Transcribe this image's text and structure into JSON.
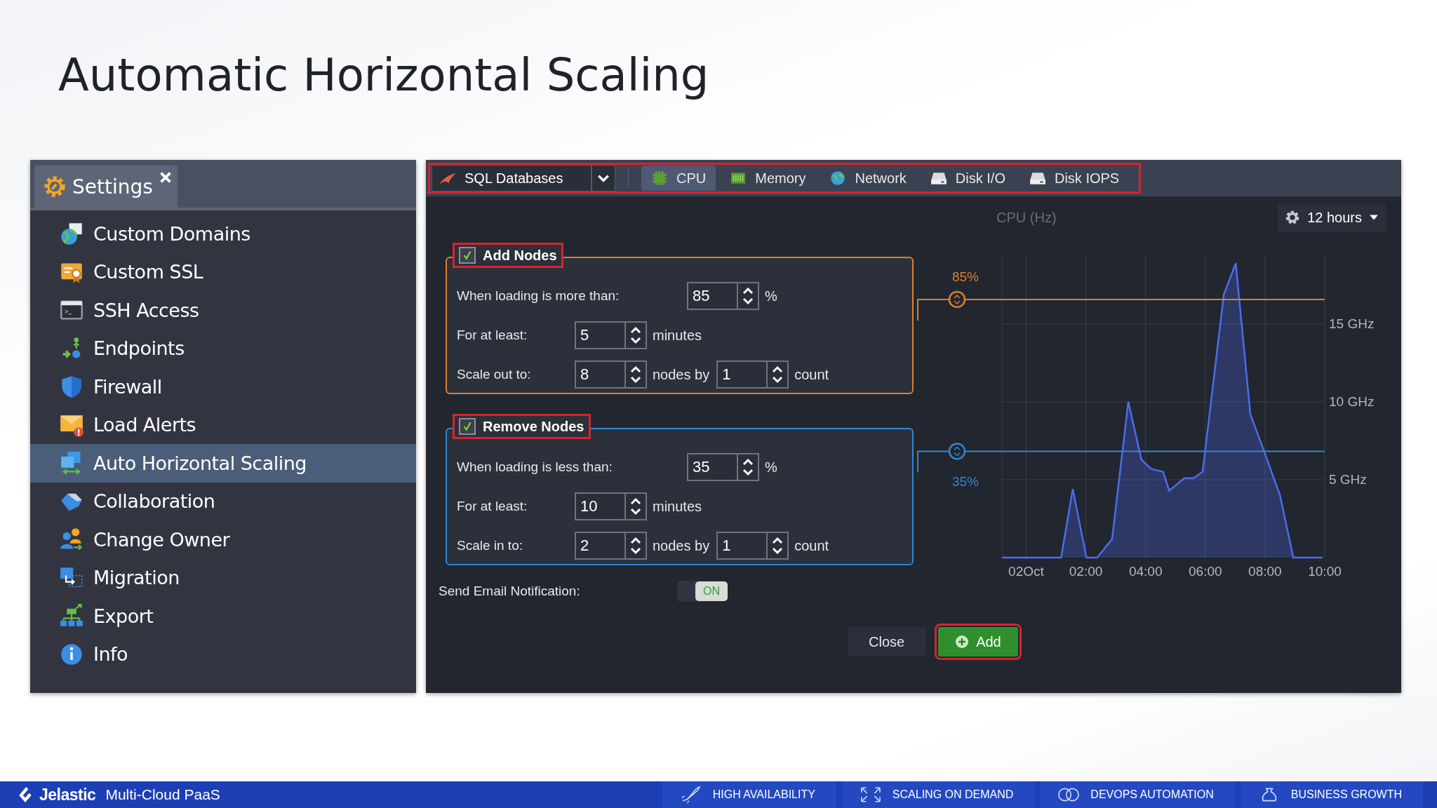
{
  "slide": {
    "title": "Automatic Horizontal Scaling"
  },
  "settings_panel": {
    "tab": "Settings",
    "items": [
      {
        "label": "Custom Domains",
        "selected": false
      },
      {
        "label": "Custom SSL",
        "selected": false
      },
      {
        "label": "SSH Access",
        "selected": false
      },
      {
        "label": "Endpoints",
        "selected": false
      },
      {
        "label": "Firewall",
        "selected": false
      },
      {
        "label": "Load Alerts",
        "selected": false
      },
      {
        "label": "Auto Horizontal Scaling",
        "selected": true
      },
      {
        "label": "Collaboration",
        "selected": false
      },
      {
        "label": "Change Owner",
        "selected": false
      },
      {
        "label": "Migration",
        "selected": false
      },
      {
        "label": "Export",
        "selected": false
      },
      {
        "label": "Info",
        "selected": false
      }
    ]
  },
  "scaling_panel": {
    "node_group": "SQL Databases",
    "tabs": [
      {
        "label": "CPU",
        "selected": true
      },
      {
        "label": "Memory",
        "selected": false
      },
      {
        "label": "Network",
        "selected": false
      },
      {
        "label": "Disk I/O",
        "selected": false
      },
      {
        "label": "Disk IOPS",
        "selected": false
      }
    ],
    "rules": [
      {
        "kind": "add",
        "label": "Add Nodes",
        "checked": true,
        "rows": [
          {
            "kind": "threshold",
            "label": "When loading is more than:",
            "value": "85",
            "unit": "%"
          },
          {
            "kind": "plain",
            "label": "For at least:",
            "value": "5",
            "unit": "minutes"
          },
          {
            "kind": "scale",
            "label": "Scale out to:",
            "value": "8",
            "unit": "nodes by",
            "value2": "1",
            "unit2": "count"
          }
        ]
      },
      {
        "kind": "remove",
        "label": "Remove Nodes",
        "checked": true,
        "rows": [
          {
            "kind": "threshold",
            "label": "When loading is less than:",
            "value": "35",
            "unit": "%"
          },
          {
            "kind": "plain",
            "label": "For at least:",
            "value": "10",
            "unit": "minutes"
          },
          {
            "kind": "scale",
            "label": "Scale in to:",
            "value": "2",
            "unit": "nodes by",
            "value2": "1",
            "unit2": "count"
          }
        ]
      }
    ],
    "email": {
      "label": "Send Email Notification:",
      "on": true,
      "toggle_text": "ON"
    },
    "buttons": [
      {
        "kind": "secondary",
        "label": "Close"
      },
      {
        "kind": "primary",
        "label": "Add"
      }
    ],
    "time_range": "12 hours",
    "chart_data": {
      "type": "area",
      "title": "CPU (Hz)",
      "x": [
        -0.81,
        1.17,
        1.56,
        2.02,
        2.38,
        2.88,
        3.42,
        3.86,
        4.18,
        4.59,
        4.79,
        5.3,
        5.6,
        5.91,
        6.62,
        7.02,
        7.51,
        7.94,
        8.5,
        8.95,
        9.93
      ],
      "grid": true,
      "series": [
        {
          "color": "#4a6cf0",
          "values": [
            0,
            0,
            4.4,
            0,
            0,
            1.2,
            10,
            6.3,
            5.7,
            5.5,
            4.3,
            5.1,
            5.1,
            5.5,
            16.9,
            18.9,
            9.2,
            7,
            4,
            0,
            0
          ]
        }
      ],
      "xlim": [
        -0.81,
        10
      ],
      "ylim": [
        0,
        19.5
      ],
      "xticks": [
        {
          "value": 0,
          "label": "02Oct"
        },
        {
          "value": 2,
          "label": "02:00"
        },
        {
          "value": 4,
          "label": "04:00"
        },
        {
          "value": 6,
          "label": "06:00"
        },
        {
          "value": 8,
          "label": "08:00"
        },
        {
          "value": 10,
          "label": "10:00"
        }
      ],
      "yticks": [
        {
          "value": 5,
          "label": "5 GHz"
        },
        {
          "value": 10,
          "label": "10 GHz"
        },
        {
          "value": 15,
          "label": "15 GHz"
        }
      ]
    },
    "thresholds": [
      {
        "label": "85%",
        "color": "#d9802f"
      },
      {
        "label": "35%",
        "color": "#2f86d4"
      }
    ]
  },
  "footer": {
    "brand": "Jelastic",
    "product": "Multi-Cloud PaaS",
    "features": [
      "HIGH AVAILABILITY",
      "SCALING ON DEMAND",
      "DEVOPS AUTOMATION",
      "BUSINESS GROWTH"
    ]
  }
}
